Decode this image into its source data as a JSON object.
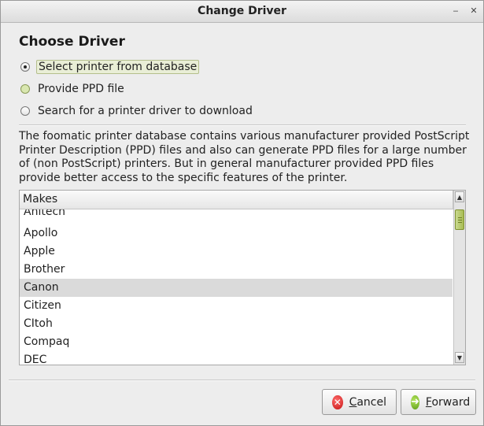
{
  "window": {
    "title": "Change Driver",
    "minimize_glyph": "‒",
    "close_glyph": "✕"
  },
  "heading": "Choose Driver",
  "options": [
    {
      "label": "Select printer from database",
      "checked": true
    },
    {
      "label": "Provide PPD file",
      "checked": false
    },
    {
      "label": "Search for a printer driver to download",
      "checked": false
    }
  ],
  "description": "The foomatic printer database contains various manufacturer provided PostScript Printer Description (PPD) files and also can generate PPD files for a large number of (non PostScript) printers. But in general manufacturer provided PPD files provide better access to the specific features of the printer.",
  "makes": {
    "header": "Makes",
    "items": [
      "Anitech",
      "Apollo",
      "Apple",
      "Brother",
      "Canon",
      "Citizen",
      "CItoh",
      "Compaq",
      "DEC"
    ],
    "selected": "Canon"
  },
  "buttons": {
    "cancel": {
      "mnemonic": "C",
      "rest": "ancel"
    },
    "forward": {
      "mnemonic": "F",
      "rest": "orward"
    }
  },
  "icons": {
    "cancel": "cancel-icon",
    "forward": "forward-icon",
    "scroll_up": "scroll-up-arrow-icon",
    "scroll_down": "scroll-down-arrow-icon"
  },
  "colors": {
    "selection": "#dadada",
    "thumb": "#a7bb52",
    "cancel": "#c51414",
    "forward": "#5f9e17"
  }
}
